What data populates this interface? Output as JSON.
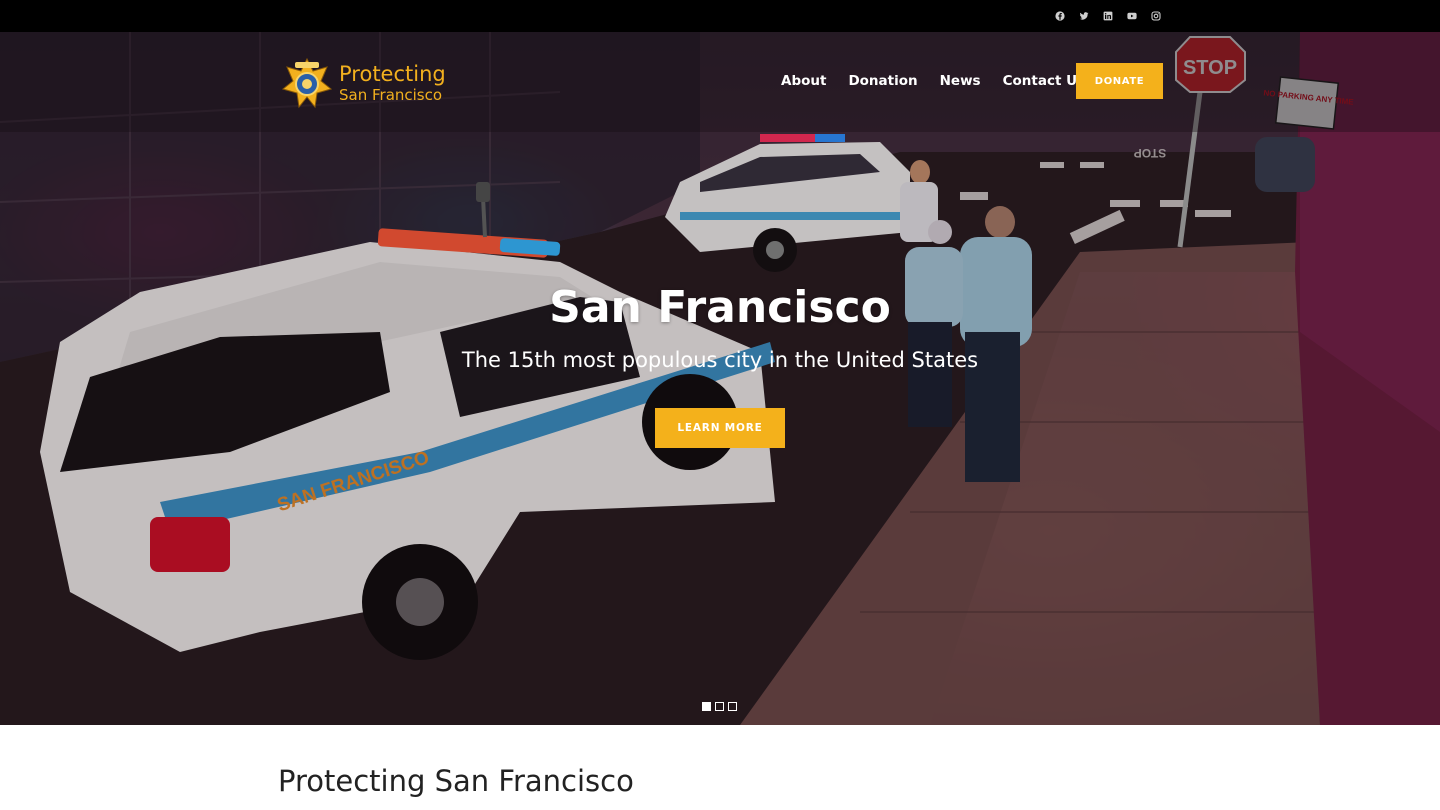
{
  "social": [
    {
      "icon": "facebook-icon"
    },
    {
      "icon": "twitter-icon"
    },
    {
      "icon": "linkedin-icon"
    },
    {
      "icon": "youtube-icon"
    },
    {
      "icon": "instagram-icon"
    }
  ],
  "logo": {
    "line1": "Protecting",
    "line2": "San Francisco"
  },
  "nav": {
    "items": [
      "About",
      "Donation",
      "News",
      "Contact Us"
    ],
    "donate_label": "DONATE"
  },
  "hero": {
    "title": "San Francisco",
    "subtitle": "The 15th most populous city in the United States",
    "button_label": "LEARN MORE",
    "slides_total": 3,
    "active_slide": 1,
    "scene_text": {
      "car_logo": "SAN FRANCISCO",
      "stop_sign": "STOP",
      "no_parking": "NO PARKING ANY TIME",
      "street_marking": "STOP"
    }
  },
  "section": {
    "title": "Protecting San Francisco"
  },
  "colors": {
    "accent": "#f4b11b",
    "topbar": "#000000"
  }
}
